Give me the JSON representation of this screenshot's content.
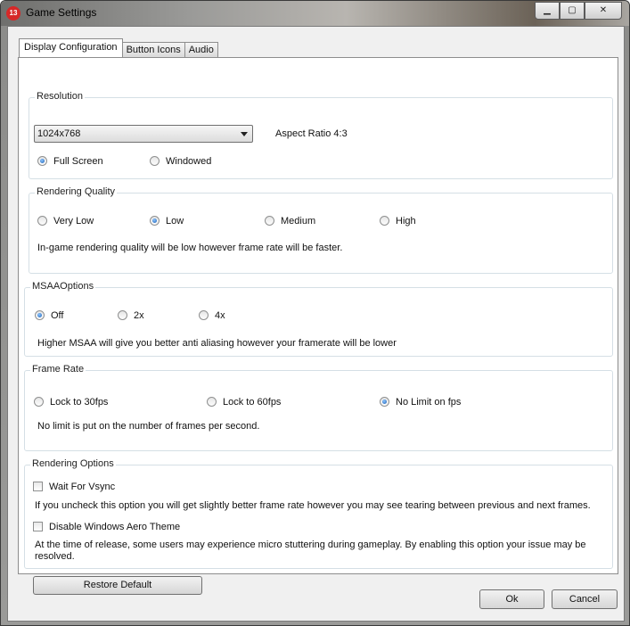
{
  "window": {
    "title": "Game Settings",
    "icon_text": "13",
    "caption_buttons": {
      "minimize": "▁",
      "maximize": "▢",
      "close": "✕"
    }
  },
  "tabs": [
    {
      "label": "Display Configuration",
      "active": true
    },
    {
      "label": "Button Icons",
      "active": false
    },
    {
      "label": "Audio",
      "active": false
    }
  ],
  "resolution": {
    "title": "Resolution",
    "selected": "1024x768",
    "aspect_ratio": "Aspect Ratio 4:3",
    "modes": [
      {
        "label": "Full Screen",
        "checked": true
      },
      {
        "label": "Windowed",
        "checked": false
      }
    ]
  },
  "rendering_quality": {
    "title": "Rendering Quality",
    "options": [
      {
        "label": "Very Low",
        "checked": false
      },
      {
        "label": "Low",
        "checked": true
      },
      {
        "label": "Medium",
        "checked": false
      },
      {
        "label": "High",
        "checked": false
      }
    ],
    "description": "In-game rendering quality will be low however frame rate will be faster."
  },
  "msaa": {
    "title": "MSAAOptions",
    "options": [
      {
        "label": "Off",
        "checked": true
      },
      {
        "label": "2x",
        "checked": false
      },
      {
        "label": "4x",
        "checked": false
      }
    ],
    "description": "Higher MSAA will give you better anti aliasing however your framerate will be lower"
  },
  "frame_rate": {
    "title": "Frame Rate",
    "options": [
      {
        "label": "Lock  to 30fps",
        "checked": false
      },
      {
        "label": "Lock to 60fps",
        "checked": false
      },
      {
        "label": "No Limit on fps",
        "checked": true
      }
    ],
    "description": "No limit is put on the number of frames per second."
  },
  "rendering_options": {
    "title": "Rendering Options",
    "vsync": {
      "label": "Wait For Vsync",
      "checked": false,
      "description": "If you uncheck this option you will get slightly better frame rate however you may see tearing between previous and next frames."
    },
    "aero": {
      "label": "Disable Windows Aero Theme",
      "checked": false,
      "description_line1": "At the time of release, some users may experience micro stuttering during gameplay. By enabling this option your issue may be",
      "description_line2": "resolved."
    }
  },
  "buttons": {
    "restore_default": "Restore Default",
    "ok": "Ok",
    "cancel": "Cancel"
  }
}
